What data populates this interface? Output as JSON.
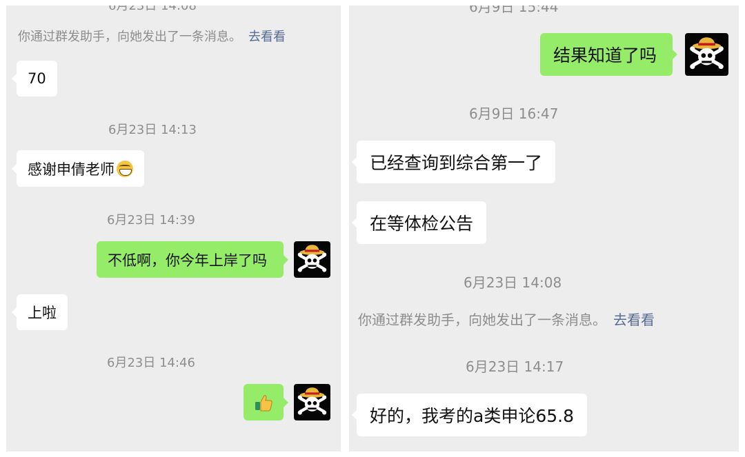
{
  "left": {
    "top_cut_timestamp": "6月23日 14:08",
    "system_note": {
      "text": "你通过群发助手，向她发出了一条消息。",
      "link": "去看看"
    },
    "messages": [
      {
        "text": "70"
      },
      {
        "timestamp": "6月23日 14:13"
      },
      {
        "text": "感谢申倩老师",
        "emoji": "grinning-face-emoji"
      },
      {
        "timestamp": "6月23日 14:39"
      },
      {
        "text": "不低啊，你今年上岸了吗"
      },
      {
        "text": "上啦"
      },
      {
        "timestamp": "6月23日 14:46"
      },
      {
        "emoji": "thumbs-up-emoji"
      }
    ]
  },
  "right": {
    "top_cut_timestamp": "6月9日 15:44",
    "messages": [
      {
        "text": "结果知道了吗"
      },
      {
        "timestamp": "6月9日 16:47"
      },
      {
        "text": "已经查询到综合第一了"
      },
      {
        "text": "在等体检公告"
      },
      {
        "timestamp": "6月23日 14:08"
      },
      {
        "timestamp": "6月23日 14:17"
      },
      {
        "text": "好的，我考的a类申论65.8"
      }
    ],
    "system_note": {
      "text": "你通过群发助手，向她发出了一条消息。",
      "link": "去看看"
    }
  },
  "colors": {
    "sent_bubble": "#95ec69",
    "received_bubble": "#ffffff",
    "chat_background": "#ededed",
    "link": "#576b95",
    "meta_text": "#8d8d8d"
  },
  "icons": {
    "avatar": "jolly-roger-straw-hat-icon"
  }
}
